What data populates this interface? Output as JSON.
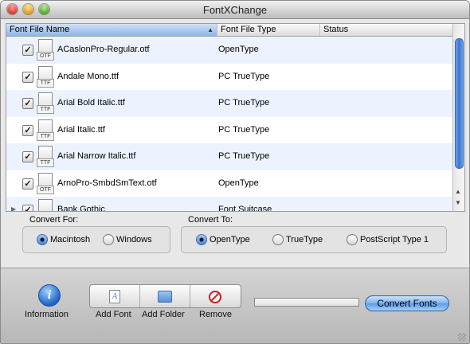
{
  "window": {
    "title": "FontXChange"
  },
  "table": {
    "columns": [
      "Font File Name",
      "Font File Type",
      "Status"
    ],
    "rows": [
      {
        "name": "ACaslonPro-Regular.otf",
        "type": "OpenType",
        "ext": "OTF",
        "checked": true
      },
      {
        "name": "Andale Mono.ttf",
        "type": "PC TrueType",
        "ext": "TTF",
        "checked": true
      },
      {
        "name": "Arial Bold Italic.ttf",
        "type": "PC TrueType",
        "ext": "TTF",
        "checked": true
      },
      {
        "name": "Arial Italic.ttf",
        "type": "PC TrueType",
        "ext": "TTF",
        "checked": true
      },
      {
        "name": "Arial Narrow Italic.ttf",
        "type": "PC TrueType",
        "ext": "TTF",
        "checked": true
      },
      {
        "name": "ArnoPro-SmbdSmText.otf",
        "type": "OpenType",
        "ext": "OTF",
        "checked": true
      },
      {
        "name": "Bank Gothic",
        "type": "Font Suitcase",
        "ext": "",
        "checked": true
      }
    ]
  },
  "convert_for": {
    "label": "Convert For:",
    "options": [
      "Macintosh",
      "Windows"
    ],
    "selected": "Macintosh"
  },
  "convert_to": {
    "label": "Convert To:",
    "options": [
      "OpenType",
      "TrueType",
      "PostScript Type 1"
    ],
    "selected": "OpenType"
  },
  "toolbar": {
    "information": "Information",
    "add_font": "Add Font",
    "add_folder": "Add Folder",
    "remove": "Remove",
    "convert": "Convert Fonts"
  },
  "colors": {
    "accent": "#3a76d0",
    "row_alt": "#edf3fe"
  }
}
